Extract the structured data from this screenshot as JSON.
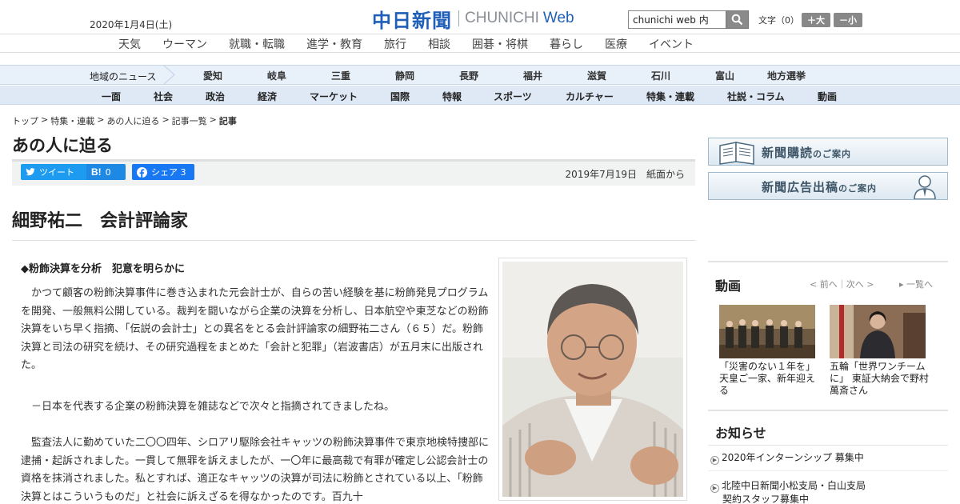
{
  "header": {
    "date": "2020年1月4日(土)",
    "logo_ja": "中日新聞",
    "logo_en": "CHUNICHI",
    "logo_web": "Web",
    "search_value": "chunichi web 内",
    "fontsize_label": "文字（0）",
    "font_up": "＋大",
    "font_down": "－小"
  },
  "category_nav": [
    "天気",
    "ウーマン",
    "就職・転職",
    "進学・教育",
    "旅行",
    "相談",
    "囲碁・将棋",
    "暮らし",
    "医療",
    "イベント"
  ],
  "region_nav": {
    "label": "地域のニュース",
    "items": [
      "愛知",
      "岐阜",
      "三重",
      "静岡",
      "長野",
      "福井",
      "滋賀",
      "石川",
      "富山",
      "地方選挙"
    ]
  },
  "section_nav": [
    "一面",
    "社会",
    "政治",
    "経済",
    "マーケット",
    "国際",
    "特報",
    "スポーツ",
    "カルチャー",
    "特集・連載",
    "社説・コラム",
    "動画"
  ],
  "breadcrumb": {
    "items": [
      "トップ",
      "特集・連載",
      "あの人に迫る",
      "記事一覧"
    ],
    "current": "記事",
    "separator": ">"
  },
  "series_title": "あの人に迫る",
  "share": {
    "twitter": "ツイート",
    "hatena_icon": "B!",
    "hatena_count": "0",
    "facebook": "シェア",
    "facebook_count": "3"
  },
  "article": {
    "date": "2019年7月19日　紙面から",
    "headline": "細野祐二　会計評論家",
    "subhead": "◆粉飾決算を分析　犯意を明らかに",
    "p1": "　かつて顧客の粉飾決算事件に巻き込まれた元会計士が、自らの苦い経験を基に粉飾発見プログラムを開発、一般無料公開している。裁判を闘いながら企業の決算を分析し、日本航空や東芝などの粉飾決算をいち早く指摘、「伝説の会計士」との異名をとる会計評論家の細野祐二さん（６５）だ。粉飾決算と司法の研究を続け、その研究過程をまとめた「会計と犯罪」（岩波書店）が五月末に出版された。",
    "p2": "　－日本を代表する企業の粉飾決算を雑誌などで次々と指摘されてきましたね。",
    "p3": "　監査法人に勤めていた二〇〇四年、シロアリ駆除会社キャッツの粉飾決算事件で東京地検特捜部に逮捕・起訴されました。一貫して無罪を訴えましたが、一〇年に最高裁で有罪が確定し公認会計士の資格を抹消されました。私とすれば、適正なキャッツの決算が司法に粉飾とされている以上、「粉飾決算とはこういうものだ」と社会に訴えざるを得なかったのです。百九十"
  },
  "sidebar": {
    "banner1_main": "新聞購読",
    "banner1_small": "のご案内",
    "banner2_main": "新聞広告出稿",
    "banner2_small": "のご案内",
    "video_title": "動画",
    "video_prev": "前へ",
    "video_next": "次へ",
    "video_all": "一覧へ",
    "videos": [
      {
        "caption": "「災害のない１年を」　天皇ご一家、新年迎える"
      },
      {
        "caption": "五輪「世界ワンチームに」 東証大納会で野村萬斎さん"
      }
    ],
    "news_title": "お知らせ",
    "news": [
      "2020年インターンシップ 募集中",
      "北陸中日新聞小松支局・白山支局",
      "契約スタッフ募集中"
    ]
  },
  "colors": {
    "brand_blue": "#1f5fb8",
    "nav_bg": "#e8f0fa",
    "twitter": "#1d9bf0",
    "hatena": "#1e88e5",
    "facebook": "#1877f2"
  }
}
